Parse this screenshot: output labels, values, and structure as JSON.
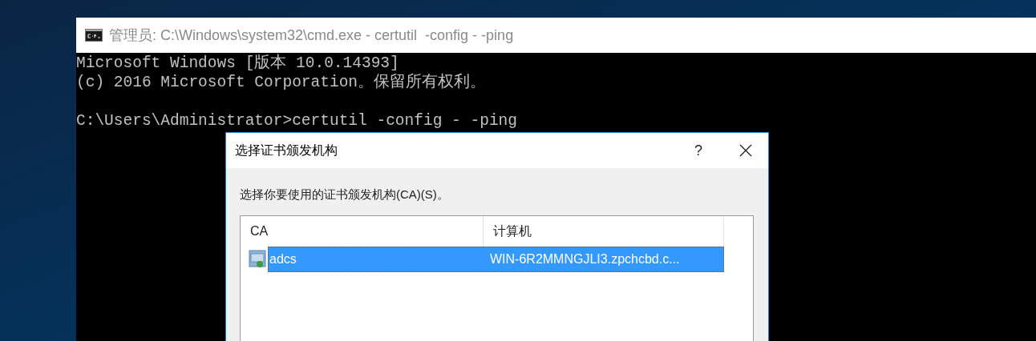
{
  "console_window": {
    "title": "管理员: C:\\Windows\\system32\\cmd.exe - certutil  -config - -ping",
    "lines": [
      {
        "text": "Microsoft Windows [版本 10.0.14393]",
        "blank_line_before": false
      },
      {
        "text": "(c) 2016 Microsoft Corporation。保留所有权利。",
        "blank_line_before": false
      },
      {
        "text": "C:\\Users\\Administrator>certutil -config - -ping",
        "blank_line_before": true
      }
    ]
  },
  "dialog": {
    "title": "选择证书颁发机构",
    "help_button": "?",
    "prompt": "选择你要使用的证书颁发机构(CA)(S)。",
    "list": {
      "columns": [
        "CA",
        "计算机"
      ],
      "rows": [
        {
          "cells": [
            "adcs",
            "WIN-6R2MMNGJLI3.zpchcbd.c..."
          ],
          "selected": true
        }
      ]
    }
  }
}
